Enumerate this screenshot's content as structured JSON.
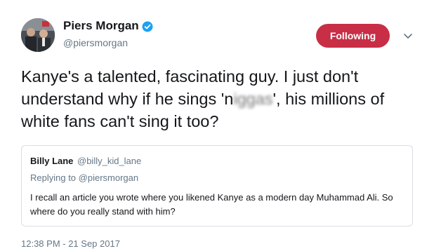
{
  "author": {
    "display_name": "Piers Morgan",
    "handle": "@piersmorgan",
    "verified": true,
    "verified_icon": "verified-badge-icon"
  },
  "follow_button": {
    "label": "Following",
    "color": "#c82e46"
  },
  "menu_icon": "chevron-down-icon",
  "tweet": {
    "text_before": "Kanye's a talented, fascinating guy. I just don't understand why if he sings 'n",
    "text_blurred": "iggas",
    "text_after": "', his millions of white fans can't sing it too?"
  },
  "quoted_tweet": {
    "display_name": "Billy Lane",
    "handle": "@billy_kid_lane",
    "replying_to": "Replying to @piersmorgan",
    "text": "I recall an article you wrote where you  likened Kanye as a modern day Muhammad Ali. So where do you really stand with him?"
  },
  "timestamp": "12:38 PM - 21 Sep 2017",
  "colors": {
    "text": "#14171a",
    "secondary": "#657786",
    "verified": "#1da1f2",
    "border": "#d8dee3"
  }
}
